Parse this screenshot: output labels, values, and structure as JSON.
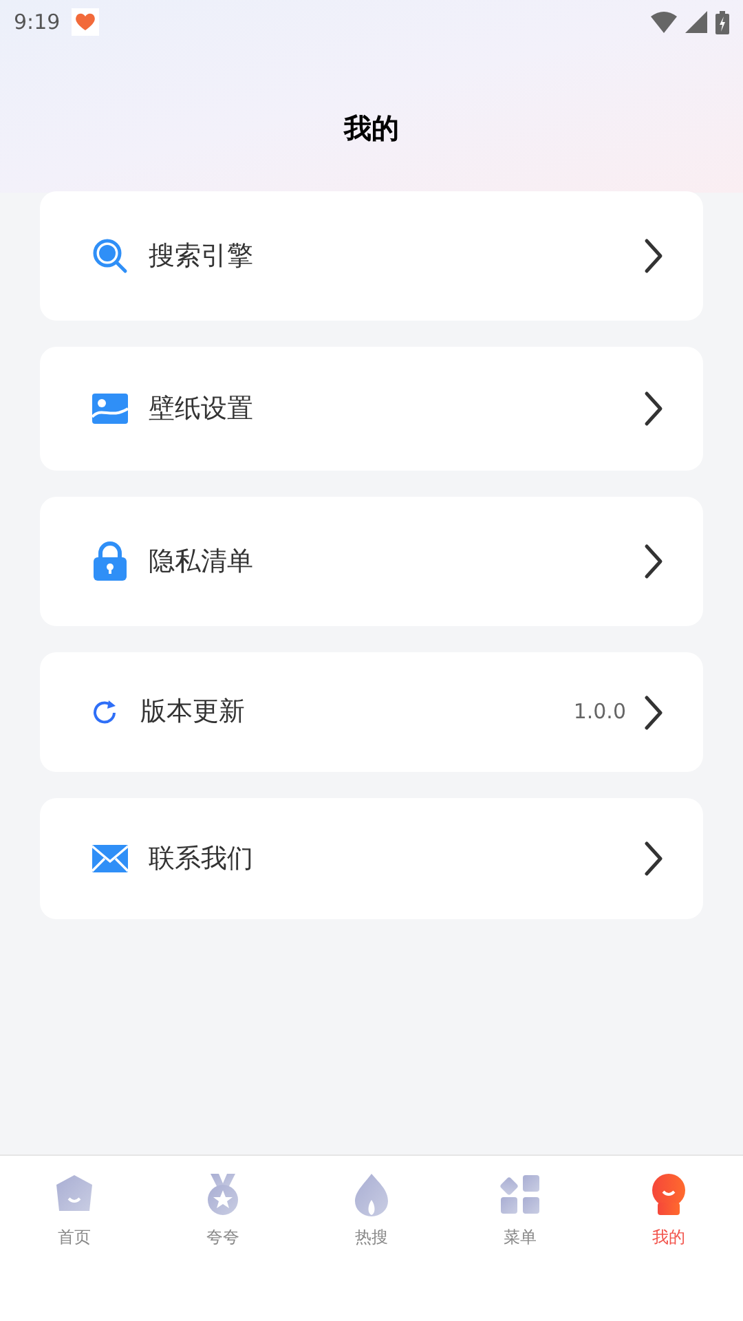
{
  "status_bar": {
    "time": "9:19"
  },
  "title": "我的",
  "menu": [
    {
      "kind": "search",
      "label": "搜索引擎"
    },
    {
      "kind": "wallpaper",
      "label": "壁纸设置"
    },
    {
      "kind": "privacy",
      "label": "隐私清单"
    },
    {
      "kind": "update",
      "label": "版本更新",
      "value": "1.0.0"
    },
    {
      "kind": "contact",
      "label": "联系我们"
    }
  ],
  "tabs": [
    {
      "kind": "home",
      "label": "首页",
      "selected": false
    },
    {
      "kind": "praise",
      "label": "夸夸",
      "selected": false
    },
    {
      "kind": "hot",
      "label": "热搜",
      "selected": false
    },
    {
      "kind": "menu",
      "label": "菜单",
      "selected": false
    },
    {
      "kind": "me",
      "label": "我的",
      "selected": true
    }
  ]
}
